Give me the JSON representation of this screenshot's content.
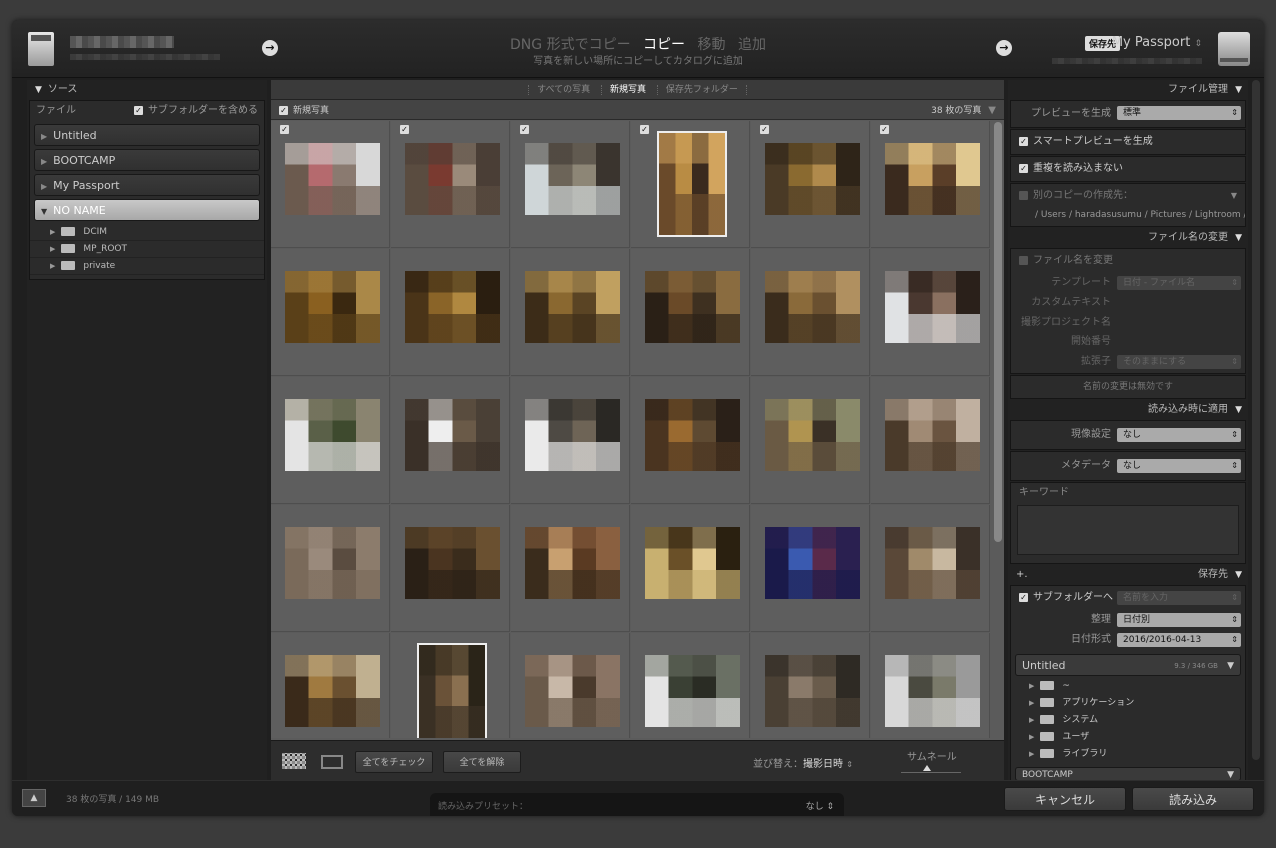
{
  "header": {
    "modes": [
      "DNG 形式でコピー",
      "コピー",
      "移動",
      "追加"
    ],
    "active_mode": "コピー",
    "subtitle": "写真を新しい場所にコピーしてカタログに追加",
    "dest_tag": "保存先",
    "dest_name": "My Passport",
    "arrow": "→"
  },
  "left": {
    "title": "ソース",
    "file_label": "ファイル",
    "subfolder_label": "サブフォルダーを含める",
    "volumes": [
      "Untitled",
      "BOOTCAMP",
      "My Passport",
      "NO NAME"
    ],
    "folders": [
      "DCIM",
      "MP_ROOT",
      "private"
    ]
  },
  "center": {
    "tabs": [
      "すべての写真",
      "新規写真",
      "保存先フォルダー"
    ],
    "active_tab": "新規写真",
    "new_photos_label": "新規写真",
    "photo_count": "38 枚の写真",
    "check_all": "全てをチェック",
    "uncheck_all": "全てを解除",
    "sort_label": "並び替え：",
    "sort_value": "撮影日時",
    "thumbnail_label": "サムネール"
  },
  "right": {
    "file_handling": {
      "title": "ファイル管理",
      "preview_label": "プレビューを生成",
      "preview_value": "標準",
      "smart_preview": "スマートプレビューを生成",
      "no_duplicates": "重複を読み込まない",
      "second_copy": "別のコピーの作成先：",
      "second_copy_path": "/ Users / haradasusumu / Pictures / Lightroom / バッ"
    },
    "rename": {
      "title": "ファイル名の変更",
      "rename_label": "ファイル名を変更",
      "template_label": "テンプレート",
      "template_value": "日付 - ファイル名",
      "custom_text": "カスタムテキスト",
      "shoot_name": "撮影プロジェクト名",
      "start_number": "開始番号",
      "extension_label": "拡張子",
      "extension_value": "そのままにする",
      "note": "名前の変更は無効です"
    },
    "apply": {
      "title": "読み込み時に適用",
      "develop_label": "現像設定",
      "develop_value": "なし",
      "metadata_label": "メタデータ",
      "metadata_value": "なし",
      "keyword_label": "キーワード"
    },
    "destination": {
      "title": "保存先",
      "plus": "+.",
      "subfolder_label": "サブフォルダーへ",
      "subfolder_placeholder": "名前を入力",
      "organize_label": "整理",
      "organize_value": "日付別",
      "date_format_label": "日付形式",
      "date_format_value": "2016/2016-04-13",
      "volume": "Untitled",
      "volume_capacity": "9.3 / 346 GB",
      "folders": [
        "~",
        "アプリケーション",
        "システム",
        "ユーザ",
        "ライブラリ"
      ],
      "next_volume": "BOOTCAMP"
    }
  },
  "footer": {
    "info": "38 枚の写真 / 149 MB",
    "preset_label": "読み込みプリセット：",
    "preset_value": "なし ⇕",
    "cancel": "キャンセル",
    "import": "読み込み"
  },
  "thumbnails": [
    {
      "colors": [
        "#6b5a4e",
        "#b56a6e",
        "#8a7a70",
        "#d8d8d8"
      ]
    },
    {
      "colors": [
        "#5a4c40",
        "#7a3a30",
        "#9a8a7a",
        "#4a3e36"
      ]
    },
    {
      "colors": [
        "#cfd6d8",
        "#6c6458",
        "#8d8676",
        "#3a342e"
      ]
    },
    {
      "colors": [
        "#6a4a2a",
        "#b98c44",
        "#3a2a1e",
        "#d2a45e"
      ],
      "portrait": true
    },
    {
      "colors": [
        "#4a3a26",
        "#8a6a30",
        "#b08a4c",
        "#2e2418"
      ]
    },
    {
      "colors": [
        "#3a2a1e",
        "#c8a060",
        "#5a3e28",
        "#e0c890"
      ]
    },
    {
      "colors": [
        "#5a4018",
        "#8a6020",
        "#3a2810",
        "#aa8848"
      ]
    },
    {
      "colors": [
        "#4a3418",
        "#8a6428",
        "#b08840",
        "#2a1e10"
      ]
    },
    {
      "colors": [
        "#3c2c18",
        "#8a6830",
        "#5a4424",
        "#c0a060"
      ]
    },
    {
      "colors": [
        "#2a2016",
        "#6a4a28",
        "#3e3020",
        "#8a6c40"
      ]
    },
    {
      "colors": [
        "#3a2c1c",
        "#8a6a3a",
        "#6a5030",
        "#b09060"
      ]
    },
    {
      "colors": [
        "#e0e2e4",
        "#4a3830",
        "#8a7060",
        "#2a201a"
      ]
    },
    {
      "colors": [
        "#e4e4e4",
        "#5a6048",
        "#3e4a2e",
        "#8a8470"
      ]
    },
    {
      "colors": [
        "#3a3028",
        "#eeeeee",
        "#6a5a48",
        "#4a4036"
      ]
    },
    {
      "colors": [
        "#eaeaea",
        "#4e4a44",
        "#6e6456",
        "#2a2824"
      ]
    },
    {
      "colors": [
        "#4a3420",
        "#9a6a30",
        "#5e4a32",
        "#2a2018"
      ]
    },
    {
      "colors": [
        "#6a5a44",
        "#b09450",
        "#3a3026",
        "#8a8a6a"
      ]
    },
    {
      "colors": [
        "#4a3a2a",
        "#a08a74",
        "#6a5440",
        "#c0b0a0"
      ]
    },
    {
      "colors": [
        "#7a6a5a",
        "#9a8a7c",
        "#5a4c40",
        "#8c7c6c"
      ]
    },
    {
      "colors": [
        "#2a2016",
        "#4a3420",
        "#3a2c1c",
        "#6a5030"
      ]
    },
    {
      "colors": [
        "#3a2c1c",
        "#c8a070",
        "#5a3a22",
        "#8a6040"
      ]
    },
    {
      "colors": [
        "#c8b070",
        "#6a5028",
        "#e0c890",
        "#2a2010"
      ]
    },
    {
      "colors": [
        "#1a1a4a",
        "#3a5ab0",
        "#5a2a4a",
        "#2a2050"
      ]
    },
    {
      "colors": [
        "#5a4838",
        "#a08a6a",
        "#c8b8a0",
        "#3a3028"
      ]
    },
    {
      "colors": [
        "#3a2a1a",
        "#a07a40",
        "#6a5030",
        "#c0b090"
      ]
    },
    {
      "colors": [
        "#3a3024",
        "#6a5238",
        "#8a7050",
        "#2a2418"
      ],
      "portrait": true
    },
    {
      "colors": [
        "#6a5a4a",
        "#c8b8a8",
        "#4a3a2c",
        "#8a7464"
      ]
    },
    {
      "colors": [
        "#e4e4e4",
        "#3a4034",
        "#2a2c24",
        "#6a7064"
      ]
    },
    {
      "colors": [
        "#4a4034",
        "#8a7a6a",
        "#6a5c4c",
        "#2e2a24"
      ]
    },
    {
      "colors": [
        "#d8d8d8",
        "#4a4a40",
        "#7a7a6a",
        "#9a9a9a"
      ]
    }
  ]
}
